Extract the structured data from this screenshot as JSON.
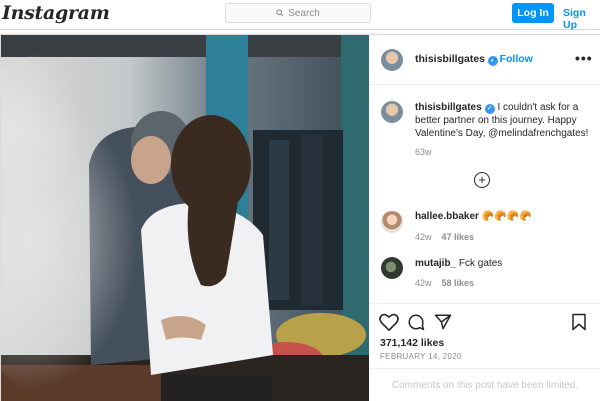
{
  "nav": {
    "logo": "Instagram",
    "search_placeholder": "Search",
    "login_label": "Log In",
    "signup_label": "Sign Up"
  },
  "post": {
    "author": "thisisbillgates",
    "follow_label": "Follow",
    "more_label": "•••",
    "caption_author": "thisisbillgates",
    "caption_text": "I couldn't ask for a better partner on this journey. Happy Valentine's Day, @melindafrenchgates!",
    "caption_age": "63w",
    "comments": [
      {
        "user": "hallee.bbaker",
        "text": "🥐🥐🥐🥐",
        "age": "42w",
        "likes": "47 likes"
      },
      {
        "user": "mutajib_",
        "text": "Fck gates",
        "age": "42w",
        "likes": "58 likes"
      }
    ],
    "likes": "371,142 likes",
    "date": "FEBRUARY 14, 2020",
    "comments_limited": "Comments on this post have been limited."
  },
  "colors": {
    "accent": "#0095f6",
    "border": "#dbdbdb",
    "muted": "#8e8e8e"
  }
}
